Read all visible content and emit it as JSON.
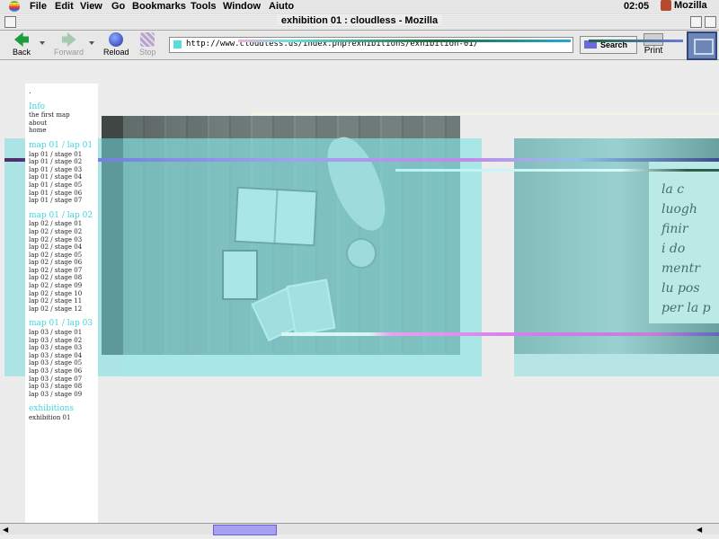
{
  "menubar": {
    "items": [
      "File",
      "Edit",
      "View",
      "Go",
      "Bookmarks",
      "Tools",
      "Window",
      "Aiuto"
    ],
    "clock": "02:05",
    "app": "Mozilla"
  },
  "window": {
    "title": "exhibition 01 : cloudless - Mozilla"
  },
  "toolbar": {
    "back": "Back",
    "forward": "Forward",
    "reload": "Reload",
    "stop": "Stop",
    "url": "http://www.cloudless.us/index.php?exhibitions/exhibition-01/",
    "search": "Search",
    "print": "Print"
  },
  "sidebar": {
    "dot": ".",
    "sections": [
      {
        "title": "Info",
        "links": [
          "the first map",
          "about",
          "home"
        ]
      },
      {
        "title": "map 01 / lap 01",
        "links": [
          "lap 01 / stage 01",
          "lap 01 / stage 02",
          "lap 01 / stage 03",
          "lap 01 / stage 04",
          "lap 01 / stage 05",
          "lap 01 / stage 06",
          "lap 01 / stage 07"
        ]
      },
      {
        "title": "map 01 / lap 02",
        "links": [
          "lap 02 / stage 01",
          "lap 02 / stage 02",
          "lap 02 / stage 03",
          "lap 02 / stage 04",
          "lap 02 / stage 05",
          "lap 02 / stage 06",
          "lap 02 / stage 07",
          "lap 02 / stage 08",
          "lap 02 / stage 09",
          "lap 02 / stage 10",
          "lap 02 / stage 11",
          "lap 02 / stage 12"
        ]
      },
      {
        "title": "map 01 / lap 03",
        "links": [
          "lap 03 / stage 01",
          "lap 03 / stage 02",
          "lap 03 / stage 03",
          "lap 03 / stage 04",
          "lap 03 / stage 05",
          "lap 03 / stage 06",
          "lap 03 / stage 07",
          "lap 03 / stage 08",
          "lap 03 / stage 09"
        ]
      },
      {
        "title": "exhibitions",
        "links": [
          "exhibition 01"
        ]
      }
    ]
  },
  "photo_script": [
    "la c",
    "luogh",
    "finir",
    "i do",
    "mentr",
    "lu pos",
    "per la p"
  ],
  "colors": {
    "accent": "#3fd6dc",
    "overlay": "#7ddfe0",
    "scroll_thumb": "#a7a0f0"
  }
}
